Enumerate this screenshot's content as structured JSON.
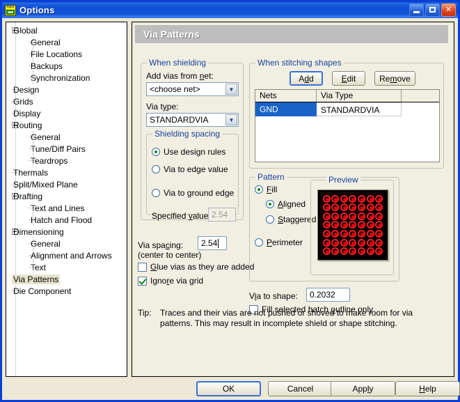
{
  "window": {
    "title": "Options",
    "app_icon": "pads-logo-icon",
    "controls": {
      "minimize": "minimize-icon",
      "maximize": "maximize-icon",
      "close": "close-icon"
    }
  },
  "tree": {
    "items": [
      {
        "label": "Global",
        "level": 0,
        "expander": "minus",
        "selected": false
      },
      {
        "label": "General",
        "level": 1,
        "expander": "none",
        "selected": false
      },
      {
        "label": "File Locations",
        "level": 1,
        "expander": "none",
        "selected": false
      },
      {
        "label": "Backups",
        "level": 1,
        "expander": "none",
        "selected": false
      },
      {
        "label": "Synchronization",
        "level": 1,
        "expander": "none",
        "selected": false
      },
      {
        "label": "Design",
        "level": 0,
        "expander": "none",
        "selected": false
      },
      {
        "label": "Grids",
        "level": 0,
        "expander": "none",
        "selected": false
      },
      {
        "label": "Display",
        "level": 0,
        "expander": "none",
        "selected": false
      },
      {
        "label": "Routing",
        "level": 0,
        "expander": "minus",
        "selected": false
      },
      {
        "label": "General",
        "level": 1,
        "expander": "none",
        "selected": false
      },
      {
        "label": "Tune/Diff Pairs",
        "level": 1,
        "expander": "none",
        "selected": false
      },
      {
        "label": "Teardrops",
        "level": 1,
        "expander": "none",
        "selected": false
      },
      {
        "label": "Thermals",
        "level": 0,
        "expander": "none",
        "selected": false
      },
      {
        "label": "Split/Mixed Plane",
        "level": 0,
        "expander": "none",
        "selected": false
      },
      {
        "label": "Drafting",
        "level": 0,
        "expander": "minus",
        "selected": false
      },
      {
        "label": "Text and Lines",
        "level": 1,
        "expander": "none",
        "selected": false
      },
      {
        "label": "Hatch and Flood",
        "level": 1,
        "expander": "none",
        "selected": false
      },
      {
        "label": "Dimensioning",
        "level": 0,
        "expander": "minus",
        "selected": false
      },
      {
        "label": "General",
        "level": 1,
        "expander": "none",
        "selected": false
      },
      {
        "label": "Alignment and Arrows",
        "level": 1,
        "expander": "none",
        "selected": false
      },
      {
        "label": "Text",
        "level": 1,
        "expander": "none",
        "selected": false
      },
      {
        "label": "Via Patterns",
        "level": 0,
        "expander": "none",
        "selected": true
      },
      {
        "label": "Die Component",
        "level": 0,
        "expander": "none",
        "selected": false
      }
    ]
  },
  "panel": {
    "header": "Via Patterns",
    "when_shielding": {
      "caption": "When shielding",
      "net_label": "Add vias from net:",
      "net_value": "<choose net>",
      "via_type_label": "Via type:",
      "via_type_value": "STANDARDVIA",
      "shielding_spacing": {
        "caption": "Shielding spacing",
        "options": [
          {
            "label": "Use design rules",
            "selected": true
          },
          {
            "label": "Via to edge value",
            "selected": false
          },
          {
            "label": "Via to ground edge",
            "selected": false
          }
        ],
        "specified_value_label": "Specified value:",
        "specified_value": "2.54",
        "specified_value_disabled": true
      }
    },
    "via_spacing": {
      "label_line1": "Via spacing:",
      "label_line2": "(center to center)",
      "value": "2.54"
    },
    "checkboxes": [
      {
        "label": "Glue vias as they are added",
        "checked": false
      },
      {
        "label": "Ignore via grid",
        "checked": true
      }
    ],
    "when_stitching": {
      "caption": "When stitching shapes",
      "buttons": [
        "Add",
        "Edit",
        "Remove"
      ],
      "table": {
        "columns": [
          "Nets",
          "Via Type"
        ],
        "rows": [
          {
            "net": "GND",
            "via_type": "STANDARDVIA",
            "selected": true
          }
        ]
      }
    },
    "pattern": {
      "caption": "Pattern",
      "options": [
        {
          "label": "Fill",
          "selected": true,
          "indent": 0
        },
        {
          "label": "Aligned",
          "selected": true,
          "indent": 1
        },
        {
          "label": "Staggered",
          "selected": false,
          "indent": 1
        },
        {
          "label": "Perimeter",
          "selected": false,
          "indent": 0
        }
      ],
      "preview": {
        "caption": "Preview",
        "rows": 7,
        "cols": 7,
        "via_color": "#ff1e1e",
        "background": "#000000"
      }
    },
    "via_to_shape": {
      "label": "Via to shape:",
      "value": "0.2032"
    },
    "fill_outline": {
      "label": "Fill selected hatch outline only",
      "checked": false
    },
    "tip": {
      "prefix": "Tip:",
      "text": "Traces and their vias are not pushed or shoved to make room for via patterns. This may result in incomplete shield or shape stitching."
    }
  },
  "footer": {
    "buttons": [
      {
        "label": "OK",
        "default": true
      },
      {
        "label": "Cancel",
        "default": false
      },
      {
        "label": "Apply",
        "default": false
      },
      {
        "label": "Help",
        "default": false
      }
    ]
  }
}
